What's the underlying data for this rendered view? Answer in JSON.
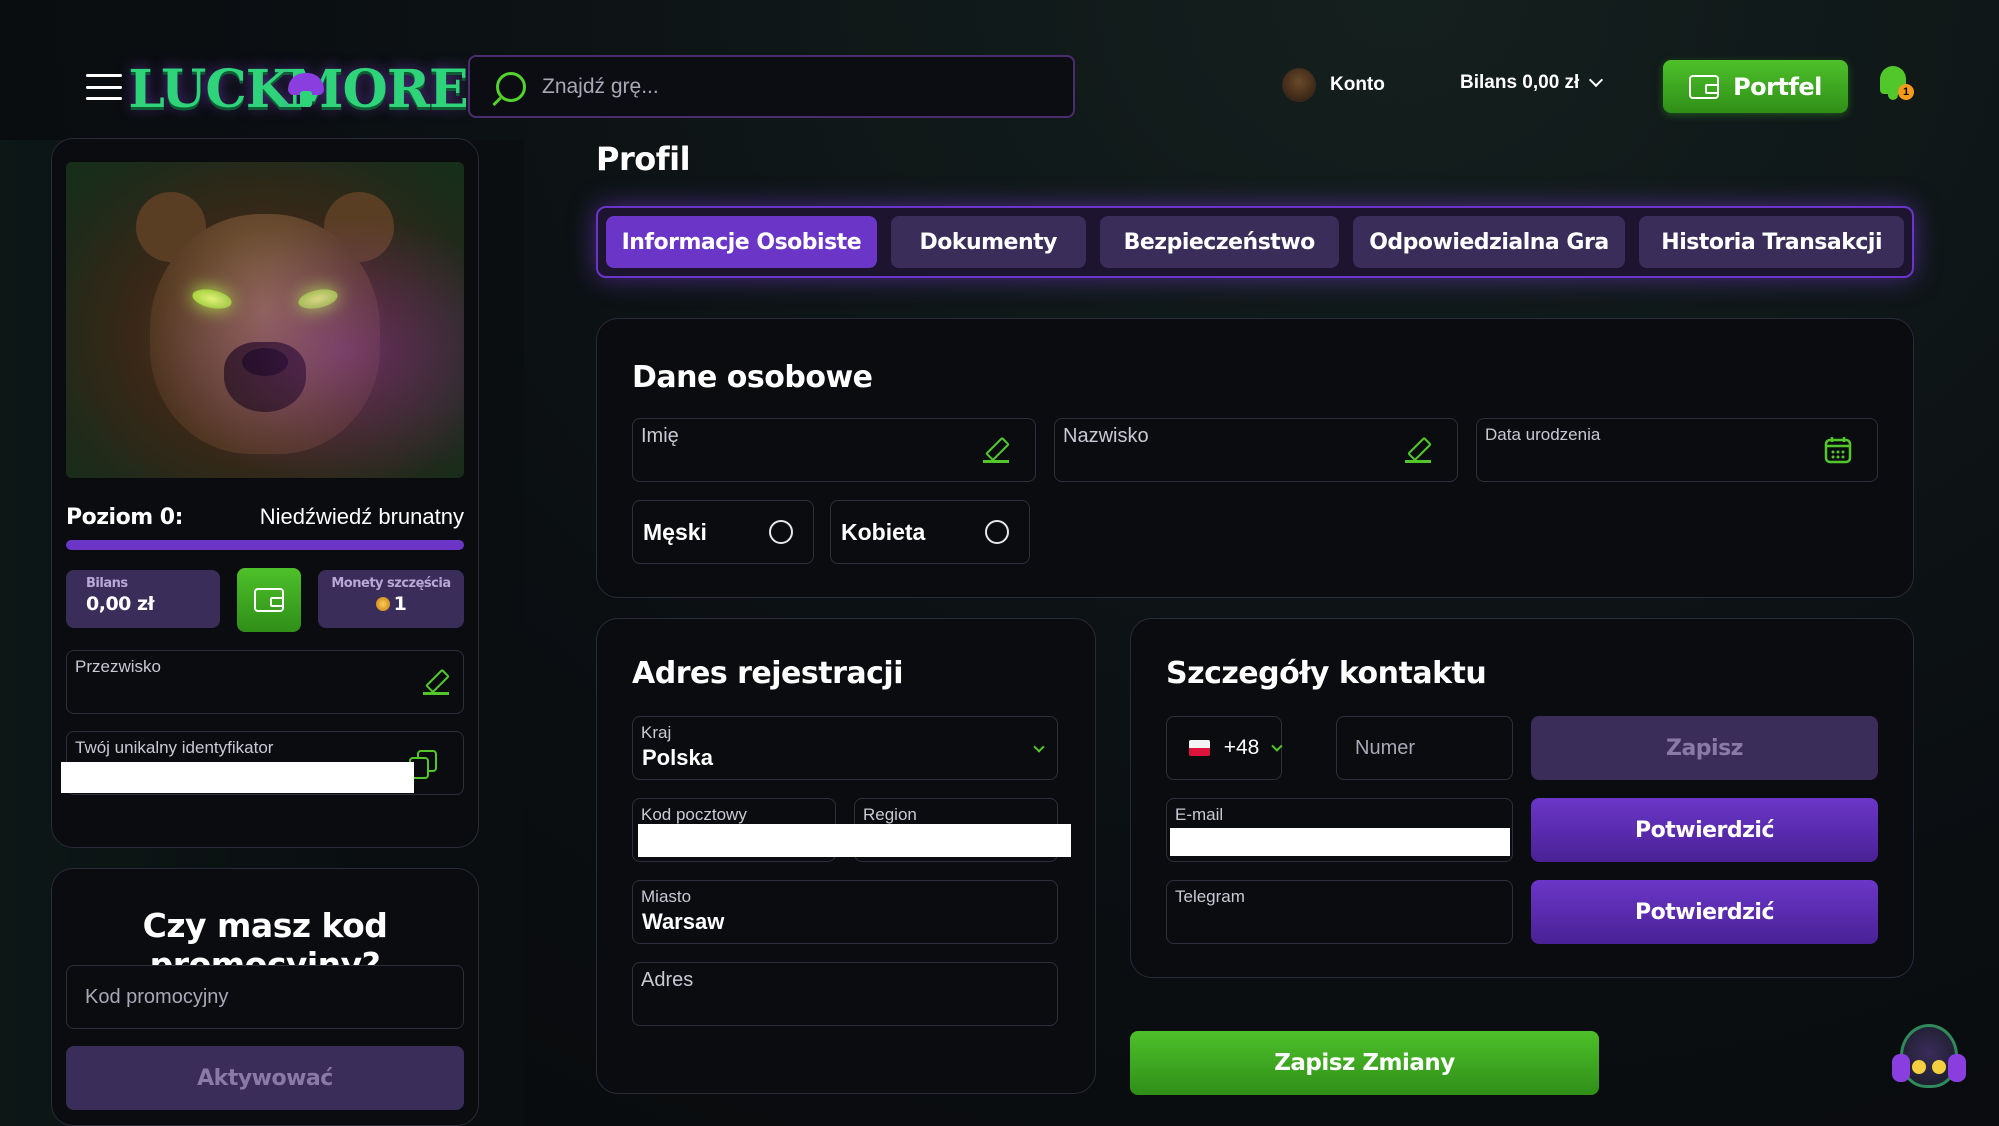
{
  "header": {
    "logo_text_left": "LUCK",
    "logo_text_right": "MORE",
    "search_placeholder": "Znajdź grę...",
    "account_label": "Konto",
    "balance_label": "Bilans 0,00 zł",
    "wallet_label": "Portfel",
    "notification_count": "1"
  },
  "sidebar": {
    "level_label": "Poziom 0:",
    "level_name": "Niedźwiedź brunatny",
    "level_progress": 1.0,
    "balance_title": "Bilans",
    "balance_value": "0,00 zł",
    "coins_title": "Monety szczęścia",
    "coins_value": "1",
    "nickname_label": "Przezwisko",
    "identifier_label": "Twój unikalny identyfikator",
    "promo_title": "Czy masz kod promocyjny?",
    "promo_placeholder": "Kod promocyjny",
    "promo_button": "Aktywować"
  },
  "main": {
    "page_title": "Profil",
    "tabs": [
      {
        "label": "Informacje Osobiste",
        "active": true
      },
      {
        "label": "Dokumenty",
        "active": false
      },
      {
        "label": "Bezpieczeństwo",
        "active": false
      },
      {
        "label": "Odpowiedzialna Gra",
        "active": false
      },
      {
        "label": "Historia Transakcji",
        "active": false
      }
    ],
    "personal": {
      "title": "Dane osobowe",
      "first_name_label": "Imię",
      "last_name_label": "Nazwisko",
      "birthdate_label": "Data urodzenia",
      "gender_male": "Męski",
      "gender_female": "Kobieta"
    },
    "address": {
      "title": "Adres rejestracji",
      "country_label": "Kraj",
      "country_value": "Polska",
      "postal_label": "Kod pocztowy",
      "region_label": "Region",
      "city_label": "Miasto",
      "city_value": "Warsaw",
      "address_label": "Adres"
    },
    "contact": {
      "title": "Szczegóły kontaktu",
      "phone_code": "+48",
      "number_placeholder": "Numer",
      "save_label": "Zapisz",
      "email_label": "E-mail",
      "confirm_email": "Potwierdzić",
      "telegram_label": "Telegram",
      "confirm_telegram": "Potwierdzić"
    },
    "save_changes": "Zapisz Zmiany"
  },
  "colors": {
    "accent_green": "#4ec02a",
    "accent_purple": "#6b36c8",
    "muted_purple": "#3a2d5a",
    "background": "#0b0c10"
  }
}
